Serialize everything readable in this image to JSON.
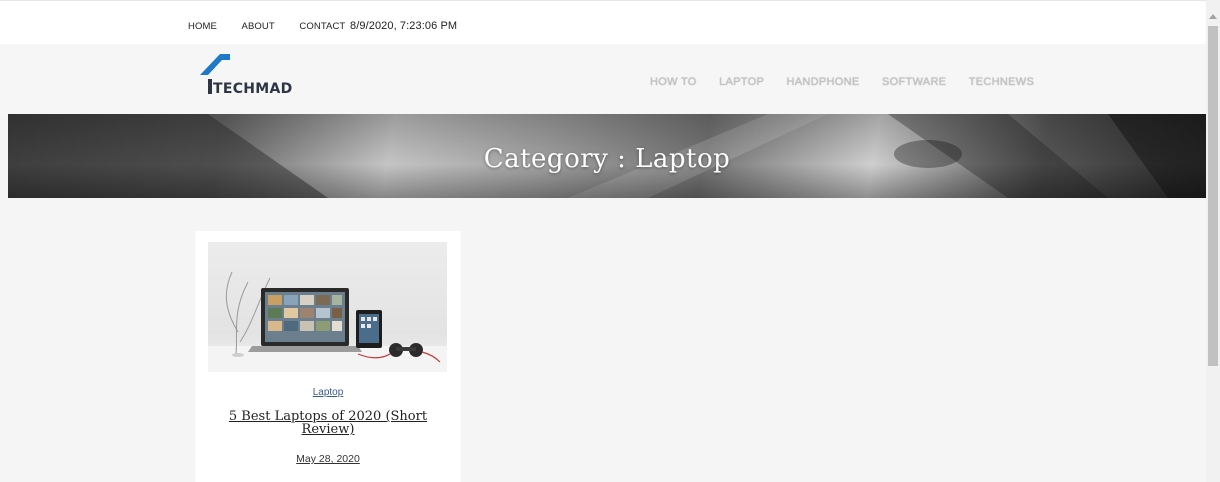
{
  "topbar": {
    "links": [
      "HOME",
      "ABOUT",
      "CONTACT"
    ],
    "datetime": "8/9/2020, 7:23:06 PM"
  },
  "header": {
    "logo_text": "TECHMAD",
    "nav": [
      "HOW TO",
      "LAPTOP",
      "HANDPHONE",
      "SOFTWARE",
      "TECHNEWS"
    ]
  },
  "hero": {
    "title": "Category : Laptop"
  },
  "post": {
    "category": "Laptop",
    "title": "5 Best Laptops of 2020 (Short Review)",
    "date": "May 28, 2020"
  },
  "colors": {
    "logo_blue": "#1f78c8",
    "logo_text": "#2d3545",
    "category_link": "#3a5c8a"
  }
}
